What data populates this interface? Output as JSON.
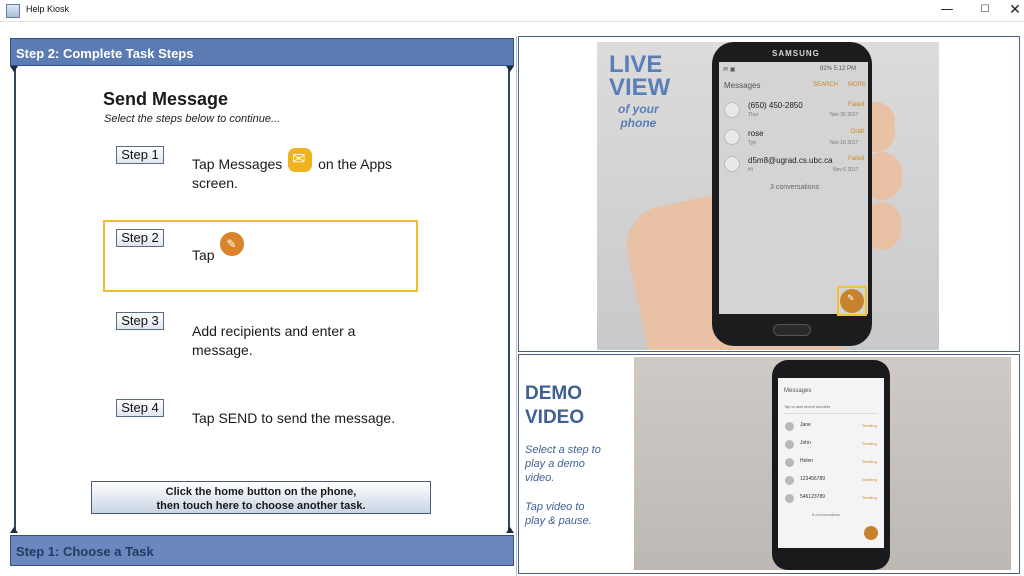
{
  "window": {
    "title": "Help Kiosk",
    "min": "—",
    "max": "☐",
    "close": "✕"
  },
  "left": {
    "header": "Step 2: Complete Task Steps",
    "task_title": "Send Message",
    "task_subtitle": "Select the steps below to continue...",
    "steps": [
      {
        "label": "Step 1",
        "text_before": "Tap Messages",
        "text_after": "on the Apps",
        "text_line2": "screen.",
        "icon": "messages-app-icon"
      },
      {
        "label": "Step 2",
        "text_before": "Tap",
        "icon": "compose-icon",
        "selected": true
      },
      {
        "label": "Step 3",
        "text_line1": "Add recipients and enter a",
        "text_line2": "message."
      },
      {
        "label": "Step 4",
        "text_line1": "Tap SEND to send the message."
      }
    ],
    "home_button_line1": "Click the home button on the phone,",
    "home_button_line2": "then touch here to choose another task.",
    "footer": "Step 1: Choose a Task"
  },
  "live": {
    "title_line1": "LIVE",
    "title_line2": "VIEW",
    "sub_line1": "of your",
    "sub_line2": "phone",
    "phone_brand": "SAMSUNG",
    "status_right": "92% 5:12 PM",
    "app_header": "Messages",
    "search": "SEARCH",
    "more": "MORE",
    "conversations": [
      {
        "name": "(650) 450-2850",
        "preview": "Thui",
        "status": "Failed",
        "date": "Nov 30 2017"
      },
      {
        "name": "rose",
        "preview": "Typ",
        "status": "Draft",
        "date": "Nov 16 2017"
      },
      {
        "name": "d5m8@ugrad.cs.ubc.ca",
        "preview": "Hi",
        "status": "Failed",
        "date": "Nov 6 2017"
      }
    ],
    "count": "3 conversations"
  },
  "demo": {
    "title_line1": "DEMO",
    "title_line2": "VIDEO",
    "text1_line1": "Select a step to",
    "text1_line2": "play a demo",
    "text1_line3": "video.",
    "text2_line1": "Tap video to",
    "text2_line2": "play & pause.",
    "video_header": "Messages",
    "video_search": "Tap to add recent senders",
    "video_rows": [
      {
        "name": "Jane",
        "status": "Sending"
      },
      {
        "name": "John",
        "status": "Sending"
      },
      {
        "name": "Helen",
        "status": "Sending"
      },
      {
        "name": "123456789",
        "status": "Sending"
      },
      {
        "name": "546123789",
        "status": "Sending"
      }
    ],
    "video_count": "5 conversations"
  }
}
